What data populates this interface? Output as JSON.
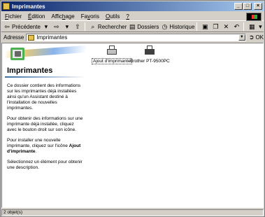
{
  "window": {
    "title": "Imprimantes"
  },
  "title_buttons": {
    "minimize": "_",
    "maximize": "□",
    "close": "×"
  },
  "menu": [
    {
      "underline": "F",
      "rest": "ichier"
    },
    {
      "underline": "É",
      "rest": "dition"
    },
    {
      "pre": "Affic",
      "underline": "h",
      "rest": "age"
    },
    {
      "pre": "Fa",
      "underline": "v",
      "rest": "oris"
    },
    {
      "underline": "O",
      "rest": "utils"
    },
    {
      "underline": "?",
      "rest": ""
    }
  ],
  "toolbar": {
    "back_label": "Précédente",
    "search_label": "Rechercher",
    "folders_label": "Dossiers",
    "history_label": "Historique"
  },
  "address": {
    "label": "Adresse",
    "value": "Imprimantes",
    "go_label": "OK"
  },
  "panel": {
    "title": "Imprimantes",
    "p1": "Ce dossier contient des informations sur les imprimantes déjà installées ainsi qu'un Assistant destiné à l'installation de nouvelles imprimantes.",
    "p2": "Pour obtenir des informations sur une imprimante déjà installée, cliquez avec le bouton droit sur son icône.",
    "p3_pre": "Pour installer une nouvelle imprimante, cliquez sur l'icône ",
    "p3_bold": "Ajout d'imprimante",
    "p3_post": ".",
    "p4": "Sélectionnez un élément pour obtenir une description."
  },
  "items": [
    {
      "label": "Ajout d'imprimante",
      "icon": "add-printer-icon"
    },
    {
      "label": "Brother PT-9500PC",
      "icon": "printer-icon"
    }
  ],
  "status": {
    "count": "2 objet(s)"
  },
  "colors": {
    "titlebar_start": "#0a246a",
    "titlebar_end": "#a6caf0",
    "face": "#d4d0c8"
  }
}
